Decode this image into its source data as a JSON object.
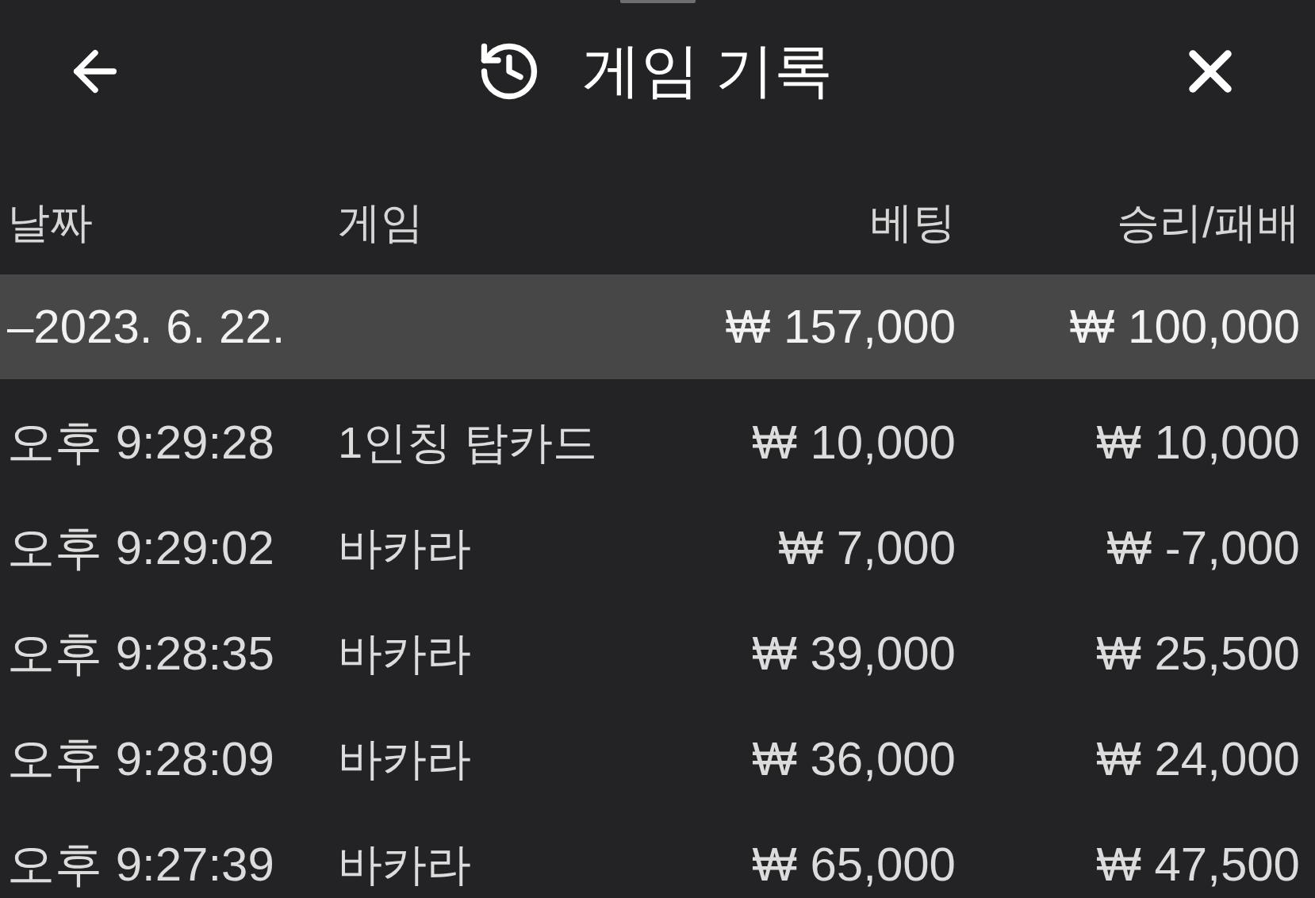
{
  "header": {
    "title": "게임 기록"
  },
  "table": {
    "columns": [
      "날짜",
      "게임",
      "베팅",
      "승리/패배"
    ],
    "groups": [
      {
        "date": "–2023. 6. 22.",
        "bet": "₩ 157,000",
        "result": "₩ 100,000",
        "rows": [
          {
            "time": "오후 9:29:28",
            "game": "1인칭 탑카드",
            "bet": "₩ 10,000",
            "result": "₩ 10,000"
          },
          {
            "time": "오후 9:29:02",
            "game": "바카라",
            "bet": "₩ 7,000",
            "result": "₩ -7,000"
          },
          {
            "time": "오후 9:28:35",
            "game": "바카라",
            "bet": "₩ 39,000",
            "result": "₩ 25,500"
          },
          {
            "time": "오후 9:28:09",
            "game": "바카라",
            "bet": "₩ 36,000",
            "result": "₩ 24,000"
          },
          {
            "time": "오후 9:27:39",
            "game": "바카라",
            "bet": "₩ 65,000",
            "result": "₩ 47,500"
          }
        ]
      }
    ]
  }
}
